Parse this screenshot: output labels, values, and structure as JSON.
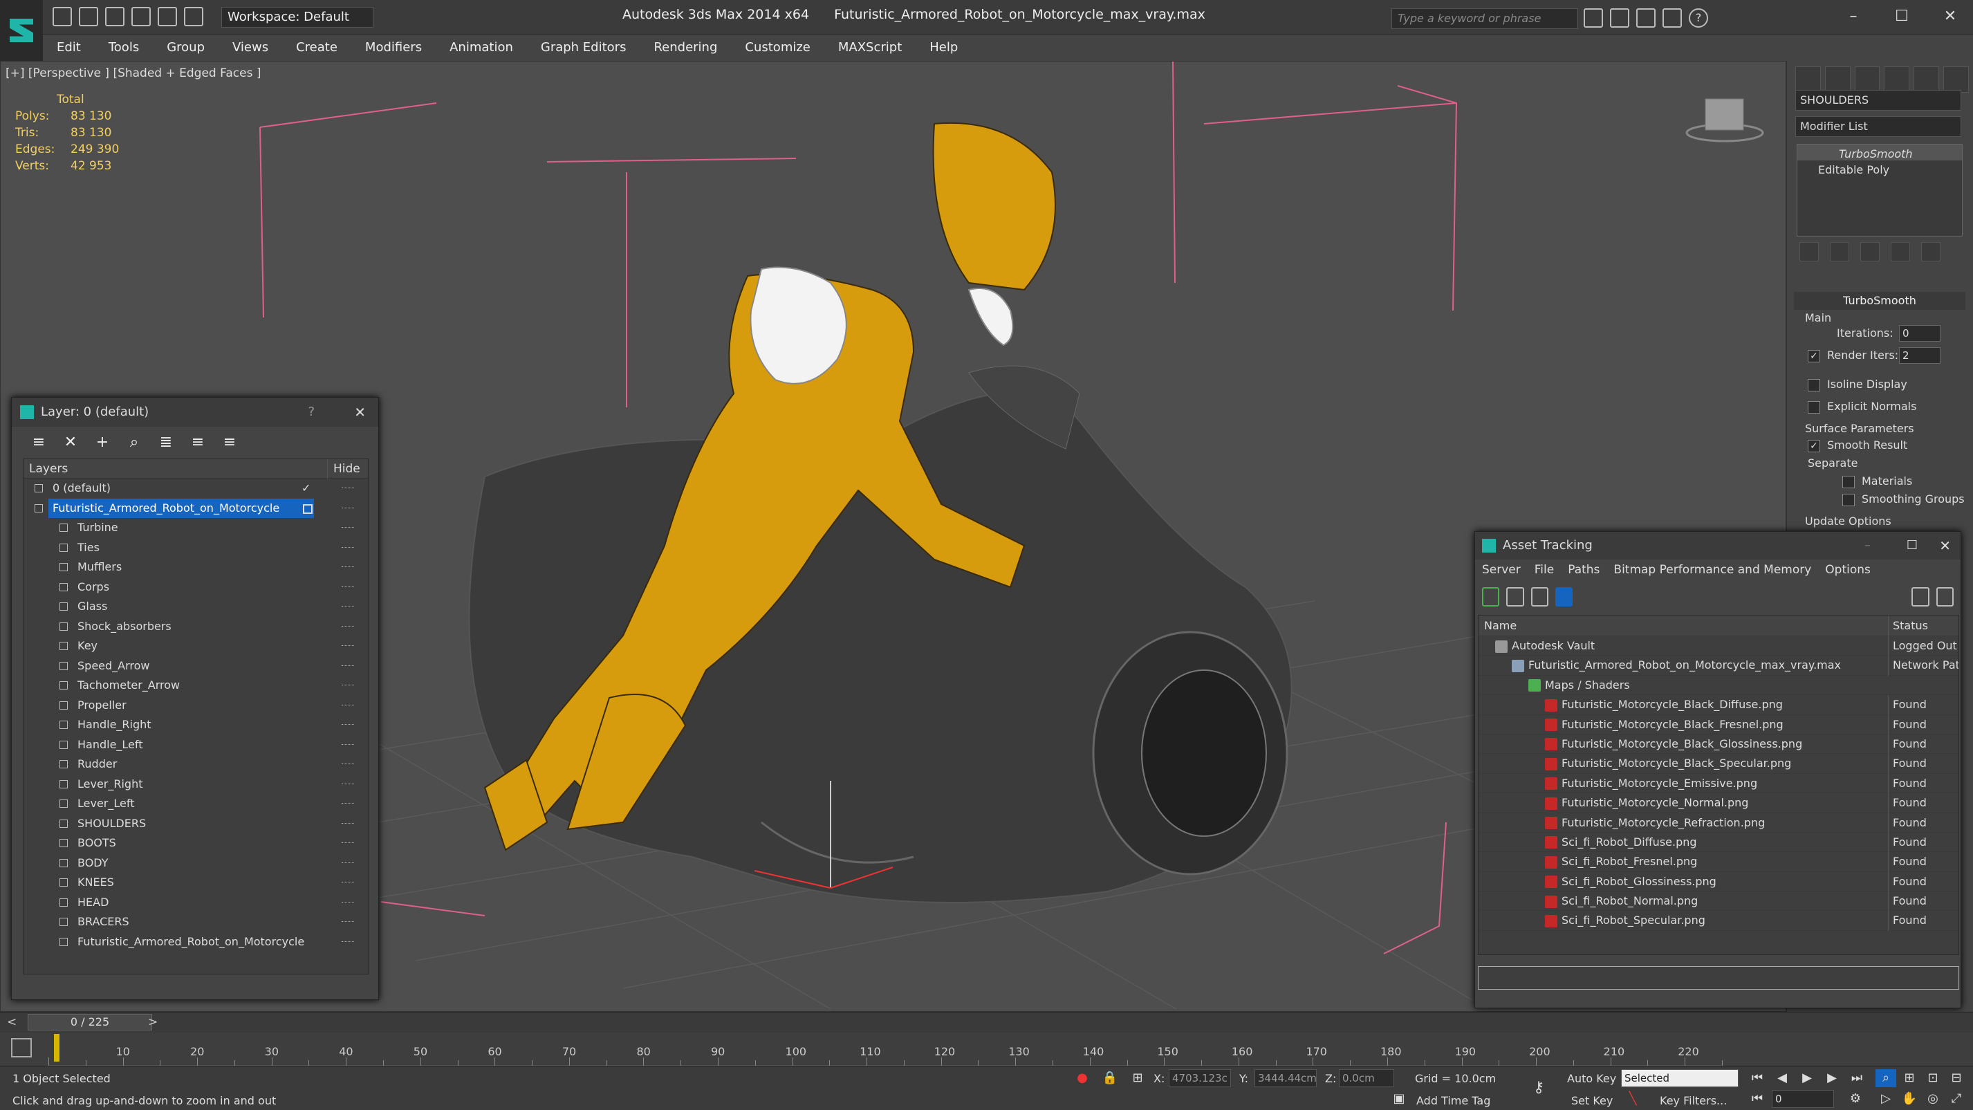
{
  "titlebar": {
    "app_name": "Autodesk 3ds Max  2014 x64",
    "file_name": "Futuristic_Armored_Robot_on_Motorcycle_max_vray.max",
    "workspace": "Workspace: Default",
    "search_placeholder": "Type a keyword or phrase",
    "help_icon": "?"
  },
  "menu": [
    "Edit",
    "Tools",
    "Group",
    "Views",
    "Create",
    "Modifiers",
    "Animation",
    "Graph Editors",
    "Rendering",
    "Customize",
    "MAXScript",
    "Help"
  ],
  "viewport": {
    "label": "[+] [Perspective ] [Shaded + Edged Faces ]",
    "stats": {
      "header": "Total",
      "polys_label": "Polys:",
      "polys": "83 130",
      "tris_label": "Tris:",
      "tris": "83 130",
      "edges_label": "Edges:",
      "edges": "249 390",
      "verts_label": "Verts:",
      "verts": "42 953"
    }
  },
  "command_panel": {
    "object_name": "SHOULDERS",
    "modifier_list": "Modifier List",
    "stack": [
      "TurboSmooth",
      "Editable Poly"
    ],
    "rollout_title": "TurboSmooth",
    "main_label": "Main",
    "iterations_label": "Iterations:",
    "iterations": "0",
    "render_iters_label": "Render Iters:",
    "render_iters": "2",
    "isoline": "Isoline Display",
    "explicit_normals": "Explicit Normals",
    "surface_params": "Surface Parameters",
    "smooth_result": "Smooth Result",
    "separate": "Separate",
    "materials": "Materials",
    "smoothing_groups": "Smoothing Groups",
    "update_options": "Update Options"
  },
  "layer_dialog": {
    "title": "Layer: 0 (default)",
    "help": "?",
    "col_layers": "Layers",
    "col_hide": "Hide",
    "rows": [
      {
        "name": "0 (default)",
        "level": 0
      },
      {
        "name": "Futuristic_Armored_Robot_on_Motorcycle",
        "level": 0,
        "selected": true
      },
      {
        "name": "Turbine",
        "level": 1
      },
      {
        "name": "Ties",
        "level": 1
      },
      {
        "name": "Mufflers",
        "level": 1
      },
      {
        "name": "Corps",
        "level": 1
      },
      {
        "name": "Glass",
        "level": 1
      },
      {
        "name": "Shock_absorbers",
        "level": 1
      },
      {
        "name": "Key",
        "level": 1
      },
      {
        "name": "Speed_Arrow",
        "level": 1
      },
      {
        "name": "Tachometer_Arrow",
        "level": 1
      },
      {
        "name": "Propeller",
        "level": 1
      },
      {
        "name": "Handle_Right",
        "level": 1
      },
      {
        "name": "Handle_Left",
        "level": 1
      },
      {
        "name": "Rudder",
        "level": 1
      },
      {
        "name": "Lever_Right",
        "level": 1
      },
      {
        "name": "Lever_Left",
        "level": 1
      },
      {
        "name": "SHOULDERS",
        "level": 1
      },
      {
        "name": "BOOTS",
        "level": 1
      },
      {
        "name": "BODY",
        "level": 1
      },
      {
        "name": "KNEES",
        "level": 1
      },
      {
        "name": "HEAD",
        "level": 1
      },
      {
        "name": "BRACERS",
        "level": 1
      },
      {
        "name": "Futuristic_Armored_Robot_on_Motorcycle",
        "level": 1
      }
    ]
  },
  "asset_dialog": {
    "title": "Asset Tracking",
    "menu": [
      "Server",
      "File",
      "Paths",
      "Bitmap Performance and Memory",
      "Options"
    ],
    "col_name": "Name",
    "col_status": "Status",
    "rows": [
      {
        "name": "Autodesk Vault",
        "status": "Logged Out",
        "level": 0
      },
      {
        "name": "Futuristic_Armored_Robot_on_Motorcycle_max_vray.max",
        "status": "Network Pat",
        "level": 1
      },
      {
        "name": "Maps / Shaders",
        "status": "",
        "level": 2
      },
      {
        "name": "Futuristic_Motorcycle_Black_Diffuse.png",
        "status": "Found",
        "level": 3
      },
      {
        "name": "Futuristic_Motorcycle_Black_Fresnel.png",
        "status": "Found",
        "level": 3
      },
      {
        "name": "Futuristic_Motorcycle_Black_Glossiness.png",
        "status": "Found",
        "level": 3
      },
      {
        "name": "Futuristic_Motorcycle_Black_Specular.png",
        "status": "Found",
        "level": 3
      },
      {
        "name": "Futuristic_Motorcycle_Emissive.png",
        "status": "Found",
        "level": 3
      },
      {
        "name": "Futuristic_Motorcycle_Normal.png",
        "status": "Found",
        "level": 3
      },
      {
        "name": "Futuristic_Motorcycle_Refraction.png",
        "status": "Found",
        "level": 3
      },
      {
        "name": "Sci_fi_Robot_Diffuse.png",
        "status": "Found",
        "level": 3
      },
      {
        "name": "Sci_fi_Robot_Fresnel.png",
        "status": "Found",
        "level": 3
      },
      {
        "name": "Sci_fi_Robot_Glossiness.png",
        "status": "Found",
        "level": 3
      },
      {
        "name": "Sci_fi_Robot_Normal.png",
        "status": "Found",
        "level": 3
      },
      {
        "name": "Sci_fi_Robot_Specular.png",
        "status": "Found",
        "level": 3
      }
    ]
  },
  "timeline": {
    "frame": "0 / 225",
    "ticks": [
      "10",
      "20",
      "30",
      "40",
      "50",
      "60",
      "70",
      "80",
      "90",
      "100",
      "110",
      "120",
      "130",
      "140",
      "150",
      "160",
      "170",
      "180",
      "190",
      "200",
      "210",
      "220"
    ]
  },
  "status": {
    "selection": "1 Object Selected",
    "hint": "Click and drag up-and-down to zoom in and out",
    "x_label": "X:",
    "x": "4703.123c",
    "y_label": "Y:",
    "y": "3444.44cm",
    "z_label": "Z:",
    "z": "0.0cm",
    "grid": "Grid = 10.0cm",
    "auto_key": "Auto Key",
    "selected": "Selected",
    "set_key": "Set Key",
    "key_filters": "Key Filters...",
    "add_time_tag": "Add Time Tag",
    "frame_field": "0"
  },
  "colors": {
    "accent": "#1565c0",
    "robot": "#d79b0e",
    "wire_pink": "#e0608a",
    "stats_yellow": "#f2d060"
  }
}
